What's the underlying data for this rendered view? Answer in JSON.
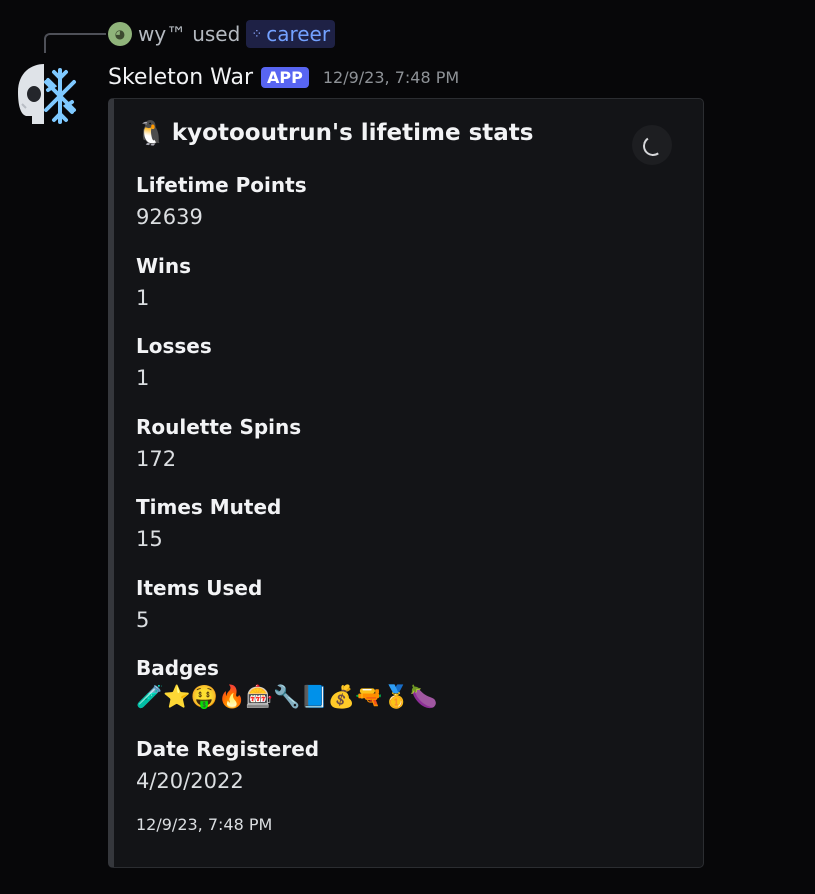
{
  "reply": {
    "user": "wy™",
    "action": "used",
    "command": "career"
  },
  "message": {
    "bot_name": "Skeleton War",
    "bot_badge": "APP",
    "timestamp": "12/9/23, 7:48 PM"
  },
  "embed": {
    "title_emoji": "🐧",
    "title": "kyotooutrun's lifetime stats",
    "fields": [
      {
        "name": "Lifetime Points",
        "value": "92639"
      },
      {
        "name": "Wins",
        "value": "1"
      },
      {
        "name": "Losses",
        "value": "1"
      },
      {
        "name": "Roulette Spins",
        "value": "172"
      },
      {
        "name": "Times Muted",
        "value": "15"
      },
      {
        "name": "Items Used",
        "value": "5"
      }
    ],
    "badges_name": "Badges",
    "badges": [
      "🧪",
      "⭐",
      "🤑",
      "🔥",
      "🎰",
      "🔧",
      "📘",
      "💰",
      "🔫",
      "🥇",
      "🍆"
    ],
    "date_field": {
      "name": "Date Registered",
      "value": "4/20/2022"
    },
    "footer": "12/9/23, 7:48 PM"
  },
  "colors": {
    "app_badge": "#5865f2",
    "command_pill": "#1e2145",
    "embed_border": "#35373c"
  }
}
